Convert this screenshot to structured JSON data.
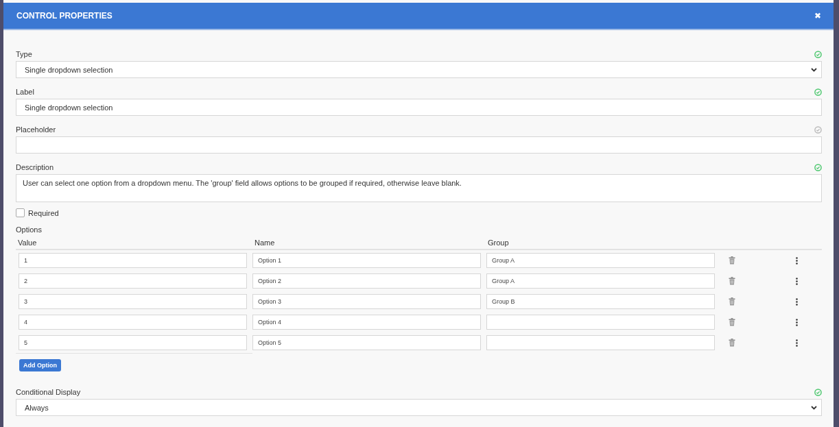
{
  "dialog": {
    "title": "CONTROL PROPERTIES",
    "close": "✖"
  },
  "fields": [
    {
      "kind": "select",
      "label": "Type",
      "value": "Single dropdown selection",
      "valid": true
    },
    {
      "kind": "text",
      "label": "Label",
      "value": "Single dropdown selection",
      "valid": true
    },
    {
      "kind": "text",
      "label": "Placeholder",
      "valid": false
    },
    {
      "kind": "textarea",
      "label": "Description",
      "value": "User can select one option from a dropdown menu. The 'group' field allows options to be grouped if required, otherwise leave blank.",
      "valid": true
    }
  ],
  "required": {
    "label": "Required",
    "checked": false
  },
  "options": {
    "title": "Options",
    "columns": [
      "Value",
      "Name",
      "Group"
    ],
    "rows": [
      {
        "value": "1",
        "name": "Option 1",
        "group": "Group A"
      },
      {
        "value": "2",
        "name": "Option 2",
        "group": "Group A"
      },
      {
        "value": "3",
        "name": "Option 3",
        "group": "Group B"
      },
      {
        "value": "4",
        "name": "Option 4"
      },
      {
        "value": "5",
        "name": "Option 5"
      }
    ],
    "add_button": "Add Option"
  },
  "conditional": {
    "kind": "select",
    "label": "Conditional Display",
    "value": "Always",
    "valid": true
  }
}
